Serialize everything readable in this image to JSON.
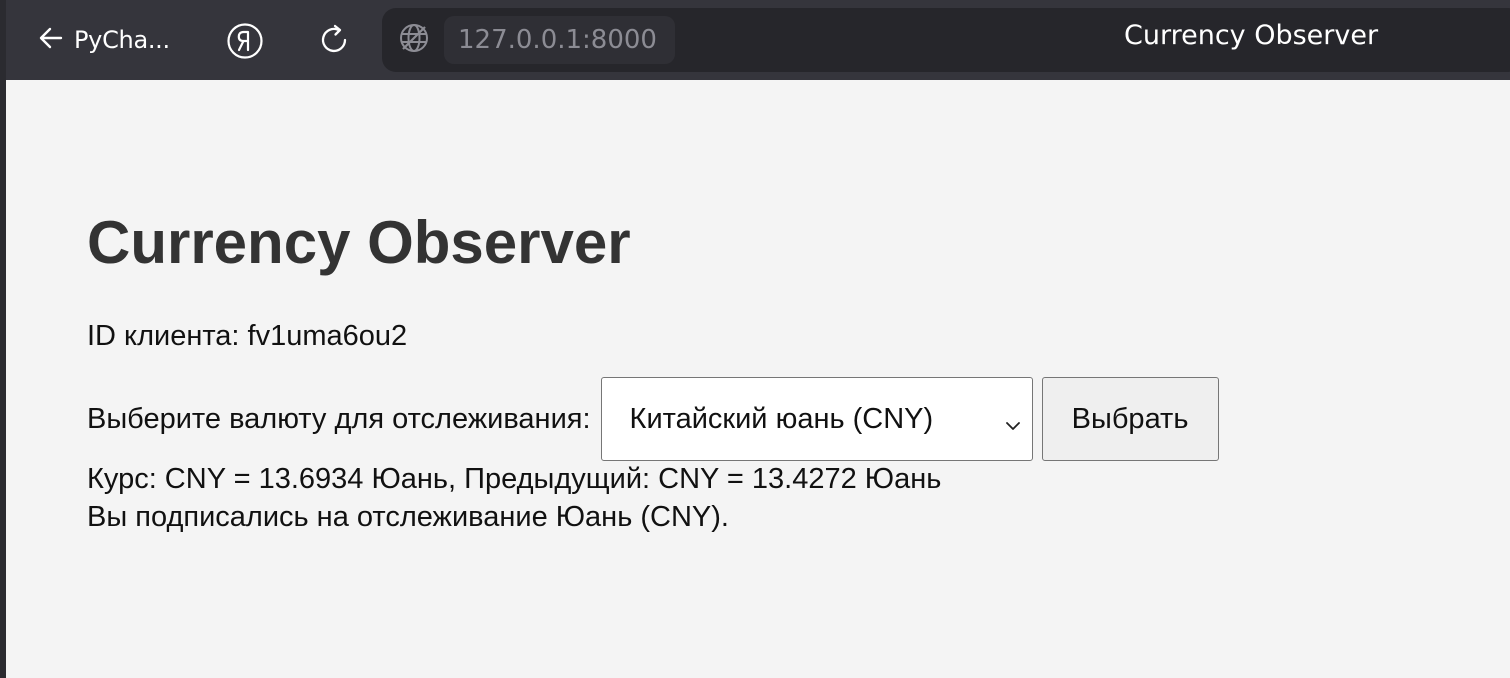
{
  "browser": {
    "back_label": "PyCha...",
    "url": "127.0.0.1:8000",
    "tab_title": "Currency Observer",
    "icons": {
      "back": "arrow-left-icon",
      "yandex": "yandex-logo-icon",
      "reload": "reload-icon",
      "site_info": "globe-icon"
    }
  },
  "page": {
    "title": "Currency Observer",
    "client_id_text": "ID клиента: fv1uma6ou2",
    "select_label": "Выберите валюту для отслеживания:",
    "select_value": "Китайский юань (CNY)",
    "choose_button": "Выбрать",
    "rate_text": "Курс: CNY = 13.6934 Юань, Предыдущий: CNY = 13.4272 Юань",
    "subscription_text": "Вы подписались на отслеживание Юань (CNY)."
  },
  "colors": {
    "toolbar": "#35353c",
    "address_bar": "#26262b",
    "page_bg": "#f4f4f4",
    "title_text": "#333333"
  }
}
